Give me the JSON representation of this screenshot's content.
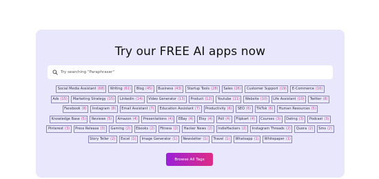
{
  "hero": {
    "title": "Try our FREE AI apps now"
  },
  "search": {
    "placeholder": "Try searching \"Paraphraser\"",
    "icon": "search-icon"
  },
  "tag_rows": [
    [
      {
        "name": "Social Media Assistant",
        "count": "(68)"
      },
      {
        "name": "Writing",
        "count": "(61)"
      },
      {
        "name": "Blog",
        "count": "(45)"
      },
      {
        "name": "Business",
        "count": "(43)"
      },
      {
        "name": "Startup Tools",
        "count": "(28)"
      },
      {
        "name": "Sales",
        "count": "(26)"
      },
      {
        "name": "Customer Support",
        "count": "(19)"
      },
      {
        "name": "E-Commerce",
        "count": "(16)"
      }
    ],
    [
      {
        "name": "Ads",
        "count": "(15)"
      },
      {
        "name": "Marketing Strategy",
        "count": "(15)"
      },
      {
        "name": "Linkedin",
        "count": "(14)"
      },
      {
        "name": "Video Generator",
        "count": "(13)"
      },
      {
        "name": "Product",
        "count": "(12)"
      },
      {
        "name": "Youtube",
        "count": "(11)"
      },
      {
        "name": "Website",
        "count": "(10)"
      },
      {
        "name": "Life Assistant",
        "count": "(10)"
      },
      {
        "name": "Twitter",
        "count": "(8)"
      }
    ],
    [
      {
        "name": "Facebook",
        "count": "(8)"
      },
      {
        "name": "Instagram",
        "count": "(8)"
      },
      {
        "name": "Email Assistant",
        "count": "(7)"
      },
      {
        "name": "Education Assistant",
        "count": "(7)"
      },
      {
        "name": "Productivity",
        "count": "(6)"
      },
      {
        "name": "SEO",
        "count": "(6)"
      },
      {
        "name": "TikTok",
        "count": "(6)"
      },
      {
        "name": "Human Resources",
        "count": "(5)"
      }
    ],
    [
      {
        "name": "Knowledge Base",
        "count": "(5)"
      },
      {
        "name": "Reviews",
        "count": "(5)"
      },
      {
        "name": "Amazon",
        "count": "(4)"
      },
      {
        "name": "Presentations",
        "count": "(4)"
      },
      {
        "name": "EBay",
        "count": "(4)"
      },
      {
        "name": "Etsy",
        "count": "(4)"
      },
      {
        "name": "Poll",
        "count": "(4)"
      },
      {
        "name": "Flipkart",
        "count": "(4)"
      },
      {
        "name": "Courses",
        "count": "(3)"
      },
      {
        "name": "Dating",
        "count": "(3)"
      },
      {
        "name": "Podcast",
        "count": "(3)"
      }
    ],
    [
      {
        "name": "Pinterest",
        "count": "(3)"
      },
      {
        "name": "Press Release",
        "count": "(3)"
      },
      {
        "name": "Gaming",
        "count": "(2)"
      },
      {
        "name": "Ebooks",
        "count": "(2)"
      },
      {
        "name": "Fitness",
        "count": "(2)"
      },
      {
        "name": "Hacker News",
        "count": "(2)"
      },
      {
        "name": "IndieHackers",
        "count": "(2)"
      },
      {
        "name": "Instagram Threads",
        "count": "(2)"
      },
      {
        "name": "Quora",
        "count": "(2)"
      },
      {
        "name": "Sms",
        "count": "(2)"
      }
    ],
    [
      {
        "name": "Story Teller",
        "count": "(2)"
      },
      {
        "name": "Excel",
        "count": "(1)"
      },
      {
        "name": "Image Generator",
        "count": "(1)"
      },
      {
        "name": "Newsletter",
        "count": "(1)"
      },
      {
        "name": "Travel",
        "count": "(1)"
      },
      {
        "name": "Whatsapp",
        "count": "(1)"
      },
      {
        "name": "Whitepaper",
        "count": "(1)"
      }
    ]
  ],
  "browse_button": {
    "label": "Browse All Tags"
  },
  "colors": {
    "panel_bg": "#e8e7fb",
    "tag_count": "#c2408f",
    "button_gradient_start": "#9a20d8",
    "button_gradient_end": "#df2c86"
  }
}
